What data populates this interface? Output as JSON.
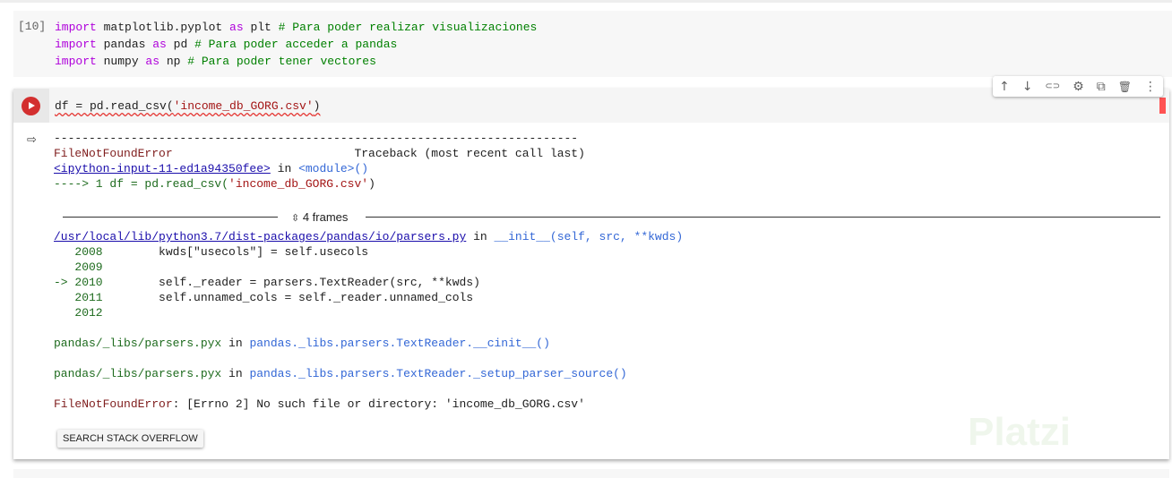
{
  "cell1": {
    "prompt": "[10]",
    "lines": [
      {
        "kw1": "import",
        "a": " matplotlib.pyplot ",
        "kw2": "as",
        "b": " plt ",
        "comment": "# Para poder realizar visualizaciones"
      },
      {
        "kw1": "import",
        "a": " pandas ",
        "kw2": "as",
        "b": " pd ",
        "comment": "# Para poder acceder a pandas"
      },
      {
        "kw1": "import",
        "a": " numpy ",
        "kw2": "as",
        "b": " np ",
        "comment": "# Para poder tener vectores"
      }
    ]
  },
  "cell2": {
    "code_prefix": "df = pd.read_csv(",
    "code_string": "'income_db_GORG.csv'",
    "code_suffix": ")",
    "toolbar": [
      "↑",
      "↓",
      "⊂⊃",
      "⚙",
      "⧉",
      "🗑",
      "⋮"
    ],
    "output": {
      "dashes": "---------------------------------------------------------------------------",
      "error_name": "FileNotFoundError",
      "traceback_hdr": "                          Traceback (most recent call last)",
      "input_link": "<ipython-input-11-ed1a94350fee>",
      "in": " in ",
      "module": "<module>()",
      "arrow_line_prefix": "----> 1 df = pd.read_csv(",
      "arrow_line_string": "'income_db_GORG.csv'",
      "arrow_line_suffix": ")",
      "frames_label": "4 frames",
      "parsers_link": "/usr/local/lib/python3.7/dist-packages/pandas/io/parsers.py",
      "init_fn": "__init__(self, src, **kwds)",
      "src_lines": [
        {
          "marker": "   ",
          "num": "2008",
          "code": "        kwds[\"usecols\"] = self.usecols"
        },
        {
          "marker": "   ",
          "num": "2009",
          "code": ""
        },
        {
          "marker": "-> ",
          "num": "2010",
          "code": "        self._reader = parsers.TextReader(src, **kwds)"
        },
        {
          "marker": "   ",
          "num": "2011",
          "code": "        self.unnamed_cols = self._reader.unnamed_cols"
        },
        {
          "marker": "   ",
          "num": "2012",
          "code": ""
        }
      ],
      "pyx1_file": "pandas/_libs/parsers.pyx",
      "pyx1_fn": "pandas._libs.parsers.TextReader.__cinit__()",
      "pyx2_file": "pandas/_libs/parsers.pyx",
      "pyx2_fn": "pandas._libs.parsers.TextReader._setup_parser_source()",
      "final_error_name": "FileNotFoundError",
      "final_error_msg": ": [Errno 2] No such file or directory: 'income_db_GORG.csv'"
    },
    "search_button": "SEARCH STACK OVERFLOW"
  },
  "watermark": "Platzi",
  "colors": {
    "run_button": "#d32f2f",
    "keyword": "#af00db",
    "comment": "#008000",
    "string": "#a31515",
    "link": "#1a0dab"
  }
}
